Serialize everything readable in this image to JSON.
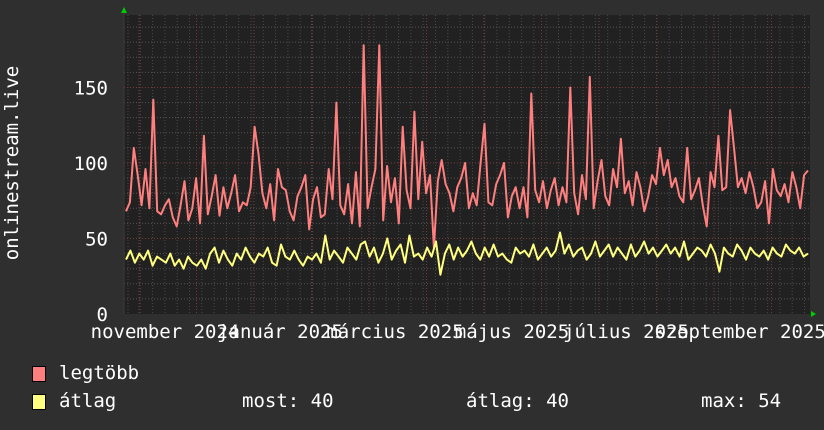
{
  "chart_data": {
    "type": "line",
    "title": "",
    "ylabel": "onlinestream.live",
    "xlabel": "",
    "ylim": [
      0,
      198
    ],
    "yticks": [
      0,
      50,
      100,
      150
    ],
    "xtick_labels": [
      "november 2024",
      "január 2025",
      "március 2025",
      "május 2025",
      "július 2025",
      "szeptember 2025"
    ],
    "grid": true,
    "series": [
      {
        "name": "legtöbb",
        "color": "#ff7f7f",
        "values": [
          68,
          74,
          110,
          92,
          72,
          96,
          70,
          142,
          68,
          66,
          72,
          76,
          64,
          58,
          72,
          88,
          62,
          70,
          90,
          60,
          118,
          66,
          78,
          92,
          65,
          84,
          70,
          80,
          92,
          68,
          74,
          72,
          84,
          124,
          106,
          80,
          70,
          86,
          62,
          96,
          84,
          82,
          68,
          62,
          78,
          84,
          92,
          56,
          76,
          84,
          64,
          66,
          96,
          76,
          140,
          72,
          66,
          86,
          60,
          94,
          58,
          178,
          70,
          84,
          96,
          178,
          62,
          98,
          74,
          90,
          60,
          124,
          82,
          70,
          134,
          76,
          114,
          80,
          92,
          44,
          88,
          102,
          86,
          80,
          68,
          84,
          90,
          100,
          70,
          80,
          72,
          100,
          126,
          74,
          72,
          86,
          92,
          100,
          64,
          78,
          84,
          70,
          84,
          64,
          146,
          82,
          74,
          88,
          70,
          82,
          90,
          72,
          84,
          74,
          150,
          80,
          66,
          92,
          76,
          157,
          70,
          88,
          102,
          78,
          72,
          96,
          84,
          116,
          80,
          88,
          72,
          94,
          84,
          68,
          78,
          92,
          86,
          110,
          92,
          102,
          84,
          90,
          78,
          74,
          110,
          76,
          82,
          90,
          72,
          58,
          94,
          84,
          118,
          82,
          84,
          135,
          110,
          84,
          90,
          80,
          94,
          84,
          70,
          74,
          88,
          60,
          96,
          82,
          78,
          86,
          74,
          94,
          84,
          70,
          92,
          95
        ]
      },
      {
        "name": "átlag",
        "color": "#ffff80",
        "values": [
          36,
          42,
          34,
          40,
          36,
          42,
          32,
          38,
          36,
          34,
          40,
          32,
          36,
          30,
          38,
          34,
          32,
          36,
          30,
          40,
          44,
          34,
          42,
          36,
          32,
          40,
          36,
          44,
          38,
          34,
          40,
          38,
          44,
          34,
          32,
          46,
          38,
          36,
          42,
          36,
          32,
          38,
          36,
          40,
          34,
          52,
          36,
          42,
          38,
          34,
          44,
          40,
          36,
          46,
          48,
          38,
          44,
          34,
          40,
          50,
          36,
          42,
          46,
          34,
          52,
          38,
          40,
          36,
          44,
          38,
          48,
          26,
          40,
          46,
          36,
          44,
          38,
          42,
          48,
          40,
          36,
          44,
          38,
          46,
          38,
          40,
          36,
          34,
          44,
          40,
          42,
          38,
          46,
          36,
          40,
          44,
          38,
          42,
          54,
          40,
          46,
          38,
          42,
          44,
          36,
          40,
          48,
          38,
          42,
          46,
          38,
          44,
          40,
          36,
          46,
          38,
          42,
          48,
          40,
          44,
          38,
          42,
          46,
          40,
          44,
          38,
          48,
          36,
          40,
          44,
          42,
          38,
          46,
          40,
          28,
          44,
          40,
          38,
          46,
          42,
          36,
          44,
          40,
          38,
          42,
          36,
          44,
          40,
          38,
          46,
          42,
          40,
          44,
          38,
          40
        ]
      }
    ]
  },
  "legend": {
    "items": [
      {
        "label": "legtöbb",
        "color": "#ff7f7f"
      },
      {
        "label": "átlag",
        "color": "#ffff80"
      }
    ],
    "stats": {
      "now": "most: 40",
      "avg": "átlag: 40",
      "max": "max: 54"
    }
  }
}
